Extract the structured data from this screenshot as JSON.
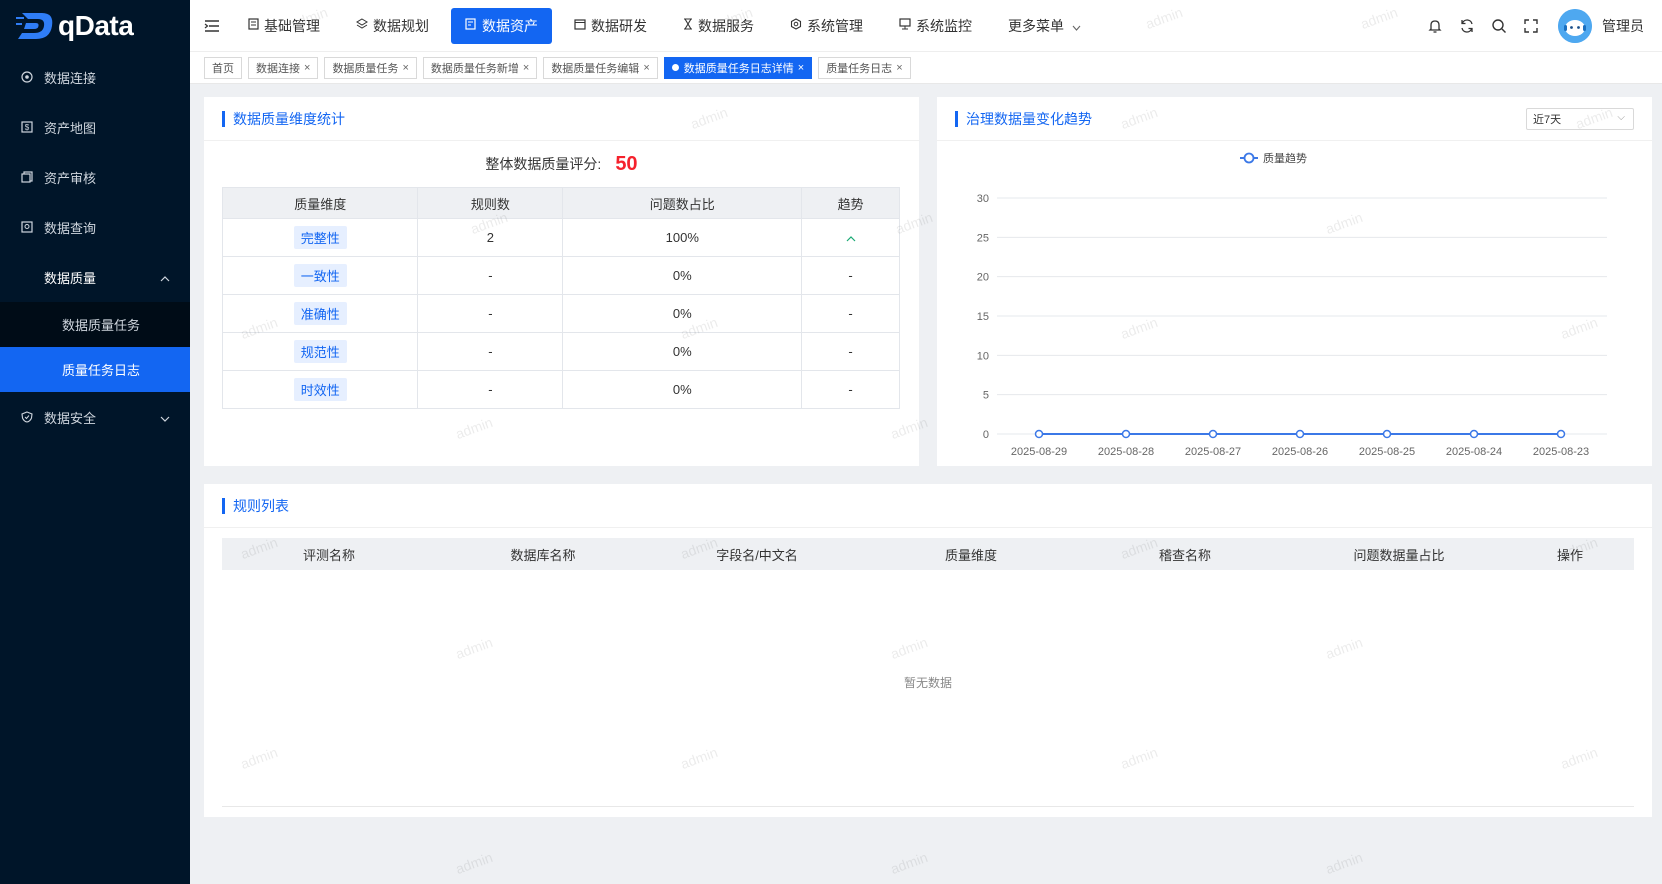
{
  "app": {
    "logo_text": "qData"
  },
  "sidebar": {
    "items": [
      {
        "label": "数据连接",
        "icon": "link-icon"
      },
      {
        "label": "资产地图",
        "icon": "map-icon"
      },
      {
        "label": "资产审核",
        "icon": "audit-icon"
      },
      {
        "label": "数据查询",
        "icon": "query-icon"
      }
    ],
    "group": {
      "label": "数据质量",
      "children": [
        {
          "label": "数据质量任务",
          "active": false
        },
        {
          "label": "质量任务日志",
          "active": true
        }
      ]
    },
    "security": {
      "label": "数据安全"
    }
  },
  "topnav": {
    "items": [
      {
        "label": "基础管理",
        "icon": "doc-icon",
        "active": false
      },
      {
        "label": "数据规划",
        "icon": "layers-icon",
        "active": false
      },
      {
        "label": "数据资产",
        "icon": "asset-icon",
        "active": true
      },
      {
        "label": "数据研发",
        "icon": "window-icon",
        "active": false
      },
      {
        "label": "数据服务",
        "icon": "hourglass-icon",
        "active": false
      },
      {
        "label": "系统管理",
        "icon": "gear-icon",
        "active": false
      },
      {
        "label": "系统监控",
        "icon": "monitor-icon",
        "active": false
      }
    ],
    "more_label": "更多菜单",
    "user_name": "管理员"
  },
  "tabs": [
    {
      "label": "首页",
      "closable": false,
      "active": false
    },
    {
      "label": "数据连接",
      "closable": true,
      "active": false
    },
    {
      "label": "数据质量任务",
      "closable": true,
      "active": false
    },
    {
      "label": "数据质量任务新增",
      "closable": true,
      "active": false
    },
    {
      "label": "数据质量任务编辑",
      "closable": true,
      "active": false
    },
    {
      "label": "数据质量任务日志详情",
      "closable": true,
      "active": true
    },
    {
      "label": "质量任务日志",
      "closable": true,
      "active": false
    }
  ],
  "dimension_panel": {
    "title": "数据质量维度统计",
    "score_label": "整体数据质量评分:",
    "score_value": "50",
    "columns": [
      "质量维度",
      "规则数",
      "问题数占比",
      "趋势"
    ],
    "rows": [
      {
        "dim": "完整性",
        "rules": "2",
        "ratio": "100%",
        "trend": "^"
      },
      {
        "dim": "一致性",
        "rules": "-",
        "ratio": "0%",
        "trend": "-"
      },
      {
        "dim": "准确性",
        "rules": "-",
        "ratio": "0%",
        "trend": "-"
      },
      {
        "dim": "规范性",
        "rules": "-",
        "ratio": "0%",
        "trend": "-"
      },
      {
        "dim": "时效性",
        "rules": "-",
        "ratio": "0%",
        "trend": "-"
      }
    ]
  },
  "trend_panel": {
    "title": "治理数据量变化趋势",
    "range_select": "近7天"
  },
  "chart_data": {
    "type": "line",
    "title": "",
    "legend": "top-center",
    "grid": true,
    "x": [
      "2025-08-29",
      "2025-08-28",
      "2025-08-27",
      "2025-08-26",
      "2025-08-25",
      "2025-08-24",
      "2025-08-23"
    ],
    "series": [
      {
        "name": "质量趋势",
        "values": [
          0,
          0,
          0,
          0,
          0,
          0,
          0
        ],
        "color": "#3b78e7"
      }
    ],
    "yticks": [
      "0",
      "5",
      "10",
      "15",
      "20",
      "25",
      "30"
    ],
    "ylim": [
      0,
      30
    ]
  },
  "rules_panel": {
    "title": "规则列表",
    "columns": [
      "评测名称",
      "数据库名称",
      "字段名/中文名",
      "质量维度",
      "稽查名称",
      "问题数据量占比",
      "操作"
    ],
    "empty_text": "暂无数据"
  },
  "watermark_text": "admin",
  "colors": {
    "primary": "#1366f2",
    "sidebar_bg": "#001529",
    "score": "#f5222d"
  }
}
